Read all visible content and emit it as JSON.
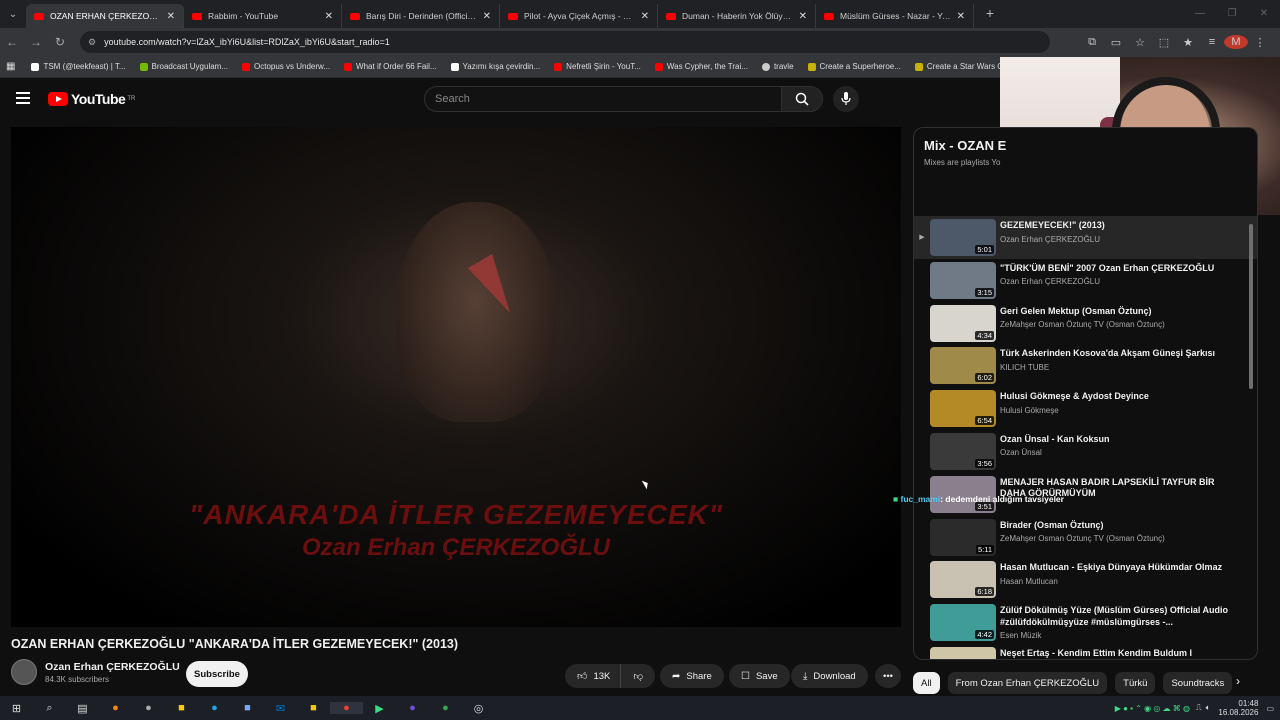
{
  "browser": {
    "tabs": [
      {
        "title": "OZAN ERHAN ÇERKEZOĞLU \"A",
        "active": true
      },
      {
        "title": "Rabbim - YouTube",
        "active": false
      },
      {
        "title": "Barış Diri - Derinden (Official Vi",
        "active": false
      },
      {
        "title": "Pilot - Ayva Çiçek Açmış - YouT",
        "active": false
      },
      {
        "title": "Duman - Haberin Yok Ölüyorum",
        "active": false
      },
      {
        "title": "Müslüm Gürses - Nazar - YouT",
        "active": false
      }
    ],
    "url": "youtube.com/watch?v=lZaX_ibYi6U&list=RDlZaX_ibYi6U&start_radio=1",
    "profile_initial": "M",
    "bookmarks": [
      {
        "label": "TSM (@teekfeast) | T...",
        "color": "#ffffff"
      },
      {
        "label": "Broadcast Uygulam...",
        "color": "#76b900"
      },
      {
        "label": "Octopus vs Underw...",
        "color": "#ff0000"
      },
      {
        "label": "What if Order 66 Fail...",
        "color": "#ff0000"
      },
      {
        "label": "Yazımı kışa çevirdin...",
        "color": "#ffffff"
      },
      {
        "label": "Nefretli Şirin - YouT...",
        "color": "#ff0000"
      },
      {
        "label": "Was Cypher, the Trai...",
        "color": "#ff0000"
      },
      {
        "label": "travle",
        "color": "#cccccc"
      },
      {
        "label": "Create a Superheroe...",
        "color": "#c8b400"
      },
      {
        "label": "Create a Star Wars C...",
        "color": "#c8b400"
      }
    ]
  },
  "youtube": {
    "logo_text": "YouTube",
    "logo_region": "TR",
    "search_placeholder": "Search"
  },
  "video": {
    "overlay_line1": "\"ANKARA'DA İTLER GEZEMEYECEK\"",
    "overlay_line2": "Ozan Erhan ÇERKEZOĞLU",
    "title": "OZAN ERHAN ÇERKEZOĞLU \"ANKARA'DA İTLER GEZEMEYECEK!\" (2013)",
    "channel": "Ozan Erhan ÇERKEZOĞLU",
    "subscribers": "84.3K subscribers",
    "subscribe_label": "Subscribe",
    "likes": "13K",
    "share_label": "Share",
    "save_label": "Save",
    "download_label": "Download"
  },
  "mix": {
    "title": "Mix - OZAN E",
    "subtitle": "Mixes are playlists Yo",
    "items": [
      {
        "title": "GEZEMEYECEK!\" (2013)",
        "channel": "Ozan Erhan ÇERKEZOĞLU",
        "duration": "5:01",
        "playing": true,
        "thumb": "#4d5868"
      },
      {
        "title": "\"TÜRK'ÜM BENİ\" 2007 Ozan Erhan ÇERKEZOĞLU",
        "channel": "Ozan Erhan ÇERKEZOĞLU",
        "duration": "3:15",
        "playing": false,
        "thumb": "#6f7a86"
      },
      {
        "title": "Geri Gelen Mektup (Osman Öztunç)",
        "channel": "ZeMahşer Osman Öztunç TV (Osman Öztunç)",
        "duration": "4:34",
        "playing": false,
        "thumb": "#d8d5cf"
      },
      {
        "title": "Türk Askerinden Kosova'da Akşam Güneşi Şarkısı",
        "channel": "KILICH TUBE",
        "duration": "6:02",
        "playing": false,
        "thumb": "#a08a4a"
      },
      {
        "title": "Hulusi Gökmeşe & Aydost Deyince",
        "channel": "Hulusi Gökmeşe",
        "duration": "6:54",
        "playing": false,
        "thumb": "#b38a26"
      },
      {
        "title": "Ozan Ünsal - Kan Koksun",
        "channel": "Ozan Ünsal",
        "duration": "3:56",
        "playing": false,
        "thumb": "#3a3a3a"
      },
      {
        "title": "MENAJER HASAN BADIR LAPSEKİLİ TAYFUR BİR DAHA GÖRÜRMÜYÜM",
        "channel": "",
        "duration": "3:51",
        "playing": false,
        "thumb": "#8a7f8c"
      },
      {
        "title": "Birader (Osman Öztunç)",
        "channel": "ZeMahşer Osman Öztunç TV (Osman Öztunç)",
        "duration": "5:11",
        "playing": false,
        "thumb": "#2b2b2b"
      },
      {
        "title": "Hasan Mutlucan - Eşkiya Dünyaya Hükümdar Olmaz",
        "channel": "Hasan Mutlucan",
        "duration": "6:18",
        "playing": false,
        "thumb": "#c9c1b2"
      },
      {
        "title": "Zülüf Dökülmüş Yüze (Müslüm Gürses) Official Audio #zülüfdökülmüşyüze #müslümgürses -...",
        "channel": "Esen Müzik",
        "duration": "4:42",
        "playing": false,
        "thumb": "#3f9c97"
      },
      {
        "title": "Neşet Ertaş - Kendim Ettim Kendim Buldum I",
        "channel": "",
        "duration": "",
        "playing": false,
        "thumb": "#cfc6a8"
      }
    ]
  },
  "chips": [
    "All",
    "From Ozan Erhan ÇERKEZOĞLU",
    "Türkü",
    "Soundtracks"
  ],
  "chat": {
    "user": "fuc_mami",
    "message": ": dedemdeni aldığım tavsiyeler"
  },
  "taskbar": {
    "time": "01:48",
    "date": "16.08.2026"
  },
  "colors": {
    "accent_red": "#ff0000",
    "background": "#0f0f0f"
  }
}
